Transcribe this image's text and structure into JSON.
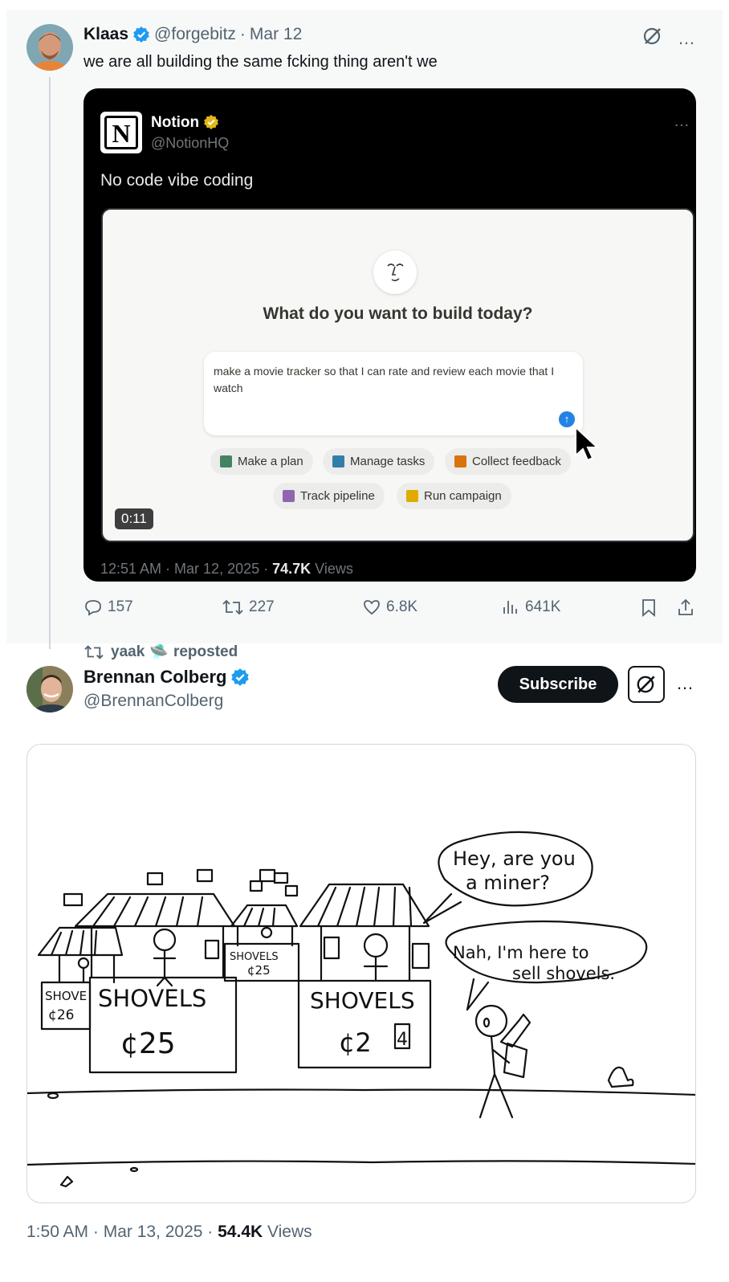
{
  "tweet1": {
    "author_name": "Klaas",
    "handle": "@forgebitz",
    "separator": "·",
    "date": "Mar 12",
    "text": "we are all building the same fcking thing aren't we",
    "more_icon": "…",
    "quoted": {
      "name": "Notion",
      "handle": "@NotionHQ",
      "logo_letter": "N",
      "more_icon": "…",
      "text": "No code vibe coding",
      "video": {
        "prompt_title": "What do you want to build today?",
        "input_text": "make a movie tracker so that I can rate and review each movie that I watch",
        "send_icon": "↑",
        "chips": [
          {
            "label": "Make a plan",
            "color": "#448361"
          },
          {
            "label": "Manage tasks",
            "color": "#337ea9"
          },
          {
            "label": "Collect feedback",
            "color": "#d9730d"
          },
          {
            "label": "Track pipeline",
            "color": "#9065b0"
          },
          {
            "label": "Run campaign",
            "color": "#dfab01"
          }
        ],
        "duration": "0:11"
      },
      "meta_time": "12:51 AM · Mar 12, 2025 · ",
      "meta_views_count": "74.7K",
      "meta_views_label": " Views"
    },
    "actions": {
      "replies": "157",
      "reposts": "227",
      "likes": "6.8K",
      "views": "641K"
    }
  },
  "tweet2": {
    "repost_prefix": "yaak",
    "repost_emoji": "🛸",
    "repost_suffix": "reposted",
    "author_name": "Brennan Colberg",
    "handle": "@BrennanColberg",
    "subscribe_label": "Subscribe",
    "more_icon": "…",
    "comic": {
      "stall_left_small": "SHOVE",
      "stall_left_small_price": "¢26",
      "stall_main_sign1": "SHOVELS",
      "stall_main_price1": "¢25",
      "stall_middle_sign": "SHOVELS",
      "stall_middle_price": "¢25",
      "stall_right_sign": "SHOVELS",
      "stall_right_price_a": "¢2",
      "stall_right_price_b": "4",
      "speech1_line1": "Hey, are you",
      "speech1_line2": "a miner?",
      "speech2_line1": "Nah, I'm here to",
      "speech2_line2": "sell shovels."
    },
    "meta_time": "1:50 AM · Mar 13, 2025 · ",
    "meta_views_count": "54.4K",
    "meta_views_label": " Views"
  },
  "colors": {
    "verified_blue": "#1d9bf0",
    "verified_gold": "#e2b719",
    "text_primary": "#0f1419",
    "text_muted": "#536471"
  }
}
